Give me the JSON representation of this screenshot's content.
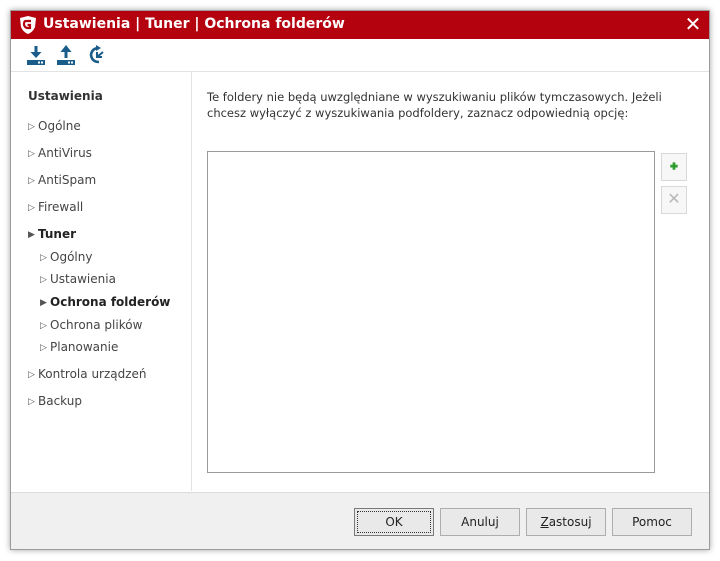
{
  "window": {
    "title": "Ustawienia | Tuner | Ochrona folderów",
    "close_label": "✕",
    "accent": "#b5020f"
  },
  "toolbar": {
    "buttons": [
      {
        "icon": "import-icon"
      },
      {
        "icon": "export-icon"
      },
      {
        "icon": "restore-defaults-icon"
      }
    ],
    "icon_color": "#1a5c8a"
  },
  "sidebar": {
    "heading": "Ustawienia",
    "items": [
      {
        "label": "Ogólne"
      },
      {
        "label": "AntiVirus"
      },
      {
        "label": "AntiSpam"
      },
      {
        "label": "Firewall"
      },
      {
        "label": "Tuner",
        "expanded": true
      },
      {
        "label": "Ogólny"
      },
      {
        "label": "Ustawienia"
      },
      {
        "label": "Ochrona folderów",
        "selected": true
      },
      {
        "label": "Ochrona plików"
      },
      {
        "label": "Planowanie"
      },
      {
        "label": "Kontrola urządzeń"
      },
      {
        "label": "Backup"
      }
    ]
  },
  "main": {
    "description": "Te foldery nie będą uwzględniane w wyszukiwaniu plików tymczasowych. Jeżeli chcesz wyłączyć z wyszukiwania podfoldery, zaznacz odpowiednią opcję:",
    "folders": [],
    "add_button_icon": "add-icon",
    "remove_button_icon": "remove-icon",
    "remove_label": "✕"
  },
  "footer": {
    "ok": "OK",
    "cancel": "Anuluj",
    "apply_first": "Z",
    "apply_rest": "astosuj",
    "help": "Pomoc"
  }
}
